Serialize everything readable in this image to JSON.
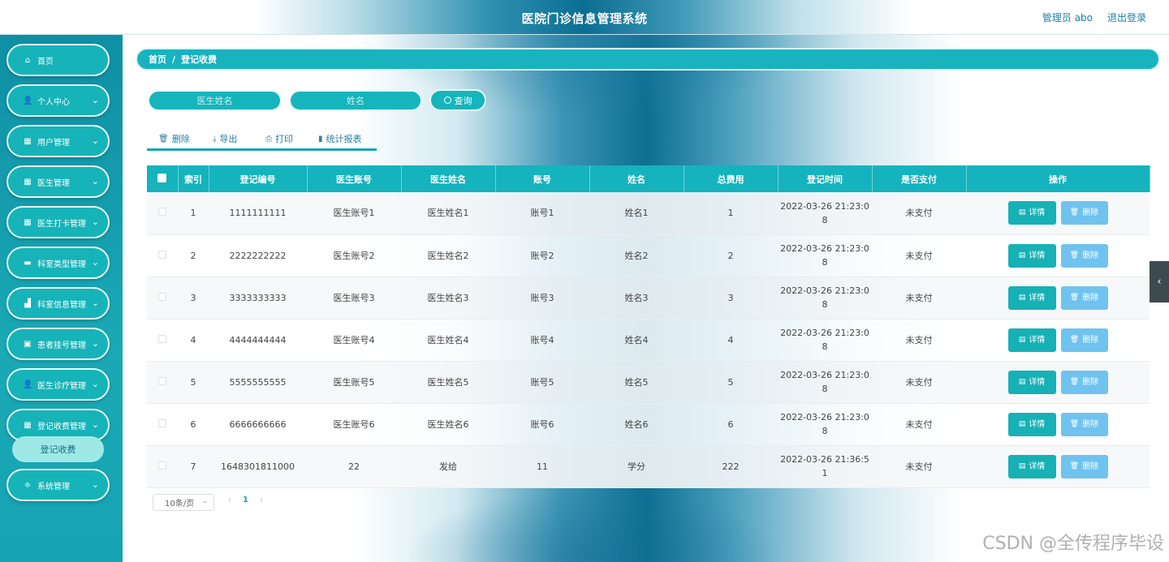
{
  "header": {
    "title": "医院门诊信息管理系统",
    "user_label": "管理员 abo",
    "logout_label": "退出登录"
  },
  "sidebar": {
    "items": [
      {
        "label": "首页",
        "icon": "home-icon",
        "has_chevron": false
      },
      {
        "label": "个人中心",
        "icon": "person-icon",
        "has_chevron": true
      },
      {
        "label": "用户管理",
        "icon": "grid-icon",
        "has_chevron": true
      },
      {
        "label": "医生管理",
        "icon": "grid-icon",
        "has_chevron": true
      },
      {
        "label": "医生打卡管理",
        "icon": "grid-icon",
        "has_chevron": true
      },
      {
        "label": "科室类型管理",
        "icon": "briefcase-icon",
        "has_chevron": true
      },
      {
        "label": "科室信息管理",
        "icon": "shop-icon",
        "has_chevron": true
      },
      {
        "label": "患者挂号管理",
        "icon": "card-icon",
        "has_chevron": true
      },
      {
        "label": "医生诊疗管理",
        "icon": "person-icon",
        "has_chevron": true
      },
      {
        "label": "登记收费管理",
        "icon": "grid-icon",
        "has_chevron": true
      },
      {
        "label": "系统管理",
        "icon": "sliders-icon",
        "has_chevron": true
      }
    ],
    "sub_item": "登记收费"
  },
  "breadcrumb": {
    "home": "首页",
    "separator": "/",
    "current": "登记收费"
  },
  "search": {
    "doctor_name_placeholder": "医生姓名",
    "name_placeholder": "姓名",
    "button_label": "查询"
  },
  "toolbar": {
    "delete_label": "删除",
    "export_label": "导出",
    "print_label": "打印",
    "report_label": "统计报表"
  },
  "table": {
    "columns": [
      "索引",
      "登记编号",
      "医生账号",
      "医生姓名",
      "账号",
      "姓名",
      "总费用",
      "登记时间",
      "是否支付",
      "操作"
    ],
    "rows": [
      {
        "index": "1",
        "reg_no": "1111111111",
        "doctor_account": "医生账号1",
        "doctor_name": "医生姓名1",
        "account": "账号1",
        "name": "姓名1",
        "total": "1",
        "time_1": "2022-03-26 21:23:0",
        "time_2": "8",
        "paid": "未支付"
      },
      {
        "index": "2",
        "reg_no": "2222222222",
        "doctor_account": "医生账号2",
        "doctor_name": "医生姓名2",
        "account": "账号2",
        "name": "姓名2",
        "total": "2",
        "time_1": "2022-03-26 21:23:0",
        "time_2": "8",
        "paid": "未支付"
      },
      {
        "index": "3",
        "reg_no": "3333333333",
        "doctor_account": "医生账号3",
        "doctor_name": "医生姓名3",
        "account": "账号3",
        "name": "姓名3",
        "total": "3",
        "time_1": "2022-03-26 21:23:0",
        "time_2": "8",
        "paid": "未支付"
      },
      {
        "index": "4",
        "reg_no": "4444444444",
        "doctor_account": "医生账号4",
        "doctor_name": "医生姓名4",
        "account": "账号4",
        "name": "姓名4",
        "total": "4",
        "time_1": "2022-03-26 21:23:0",
        "time_2": "8",
        "paid": "未支付"
      },
      {
        "index": "5",
        "reg_no": "5555555555",
        "doctor_account": "医生账号5",
        "doctor_name": "医生姓名5",
        "account": "账号5",
        "name": "姓名5",
        "total": "5",
        "time_1": "2022-03-26 21:23:0",
        "time_2": "8",
        "paid": "未支付"
      },
      {
        "index": "6",
        "reg_no": "6666666666",
        "doctor_account": "医生账号6",
        "doctor_name": "医生姓名6",
        "account": "账号6",
        "name": "姓名6",
        "total": "6",
        "time_1": "2022-03-26 21:23:0",
        "time_2": "8",
        "paid": "未支付"
      },
      {
        "index": "7",
        "reg_no": "1648301811000",
        "doctor_account": "22",
        "doctor_name": "发给",
        "account": "11",
        "name": "学分",
        "total": "222",
        "time_1": "2022-03-26 21:36:5",
        "time_2": "1",
        "paid": "未支付"
      }
    ],
    "detail_label": "详情",
    "delete_label": "删除"
  },
  "pagination": {
    "page_size": "10条/页",
    "prev": "‹",
    "current_page": "1",
    "next": "›"
  },
  "watermark": "CSDN @全传程序毕设",
  "colors": {
    "accent": "#16b3bb",
    "delete_button": "#6fc3ee",
    "sidebar": "#1aa9b5"
  }
}
